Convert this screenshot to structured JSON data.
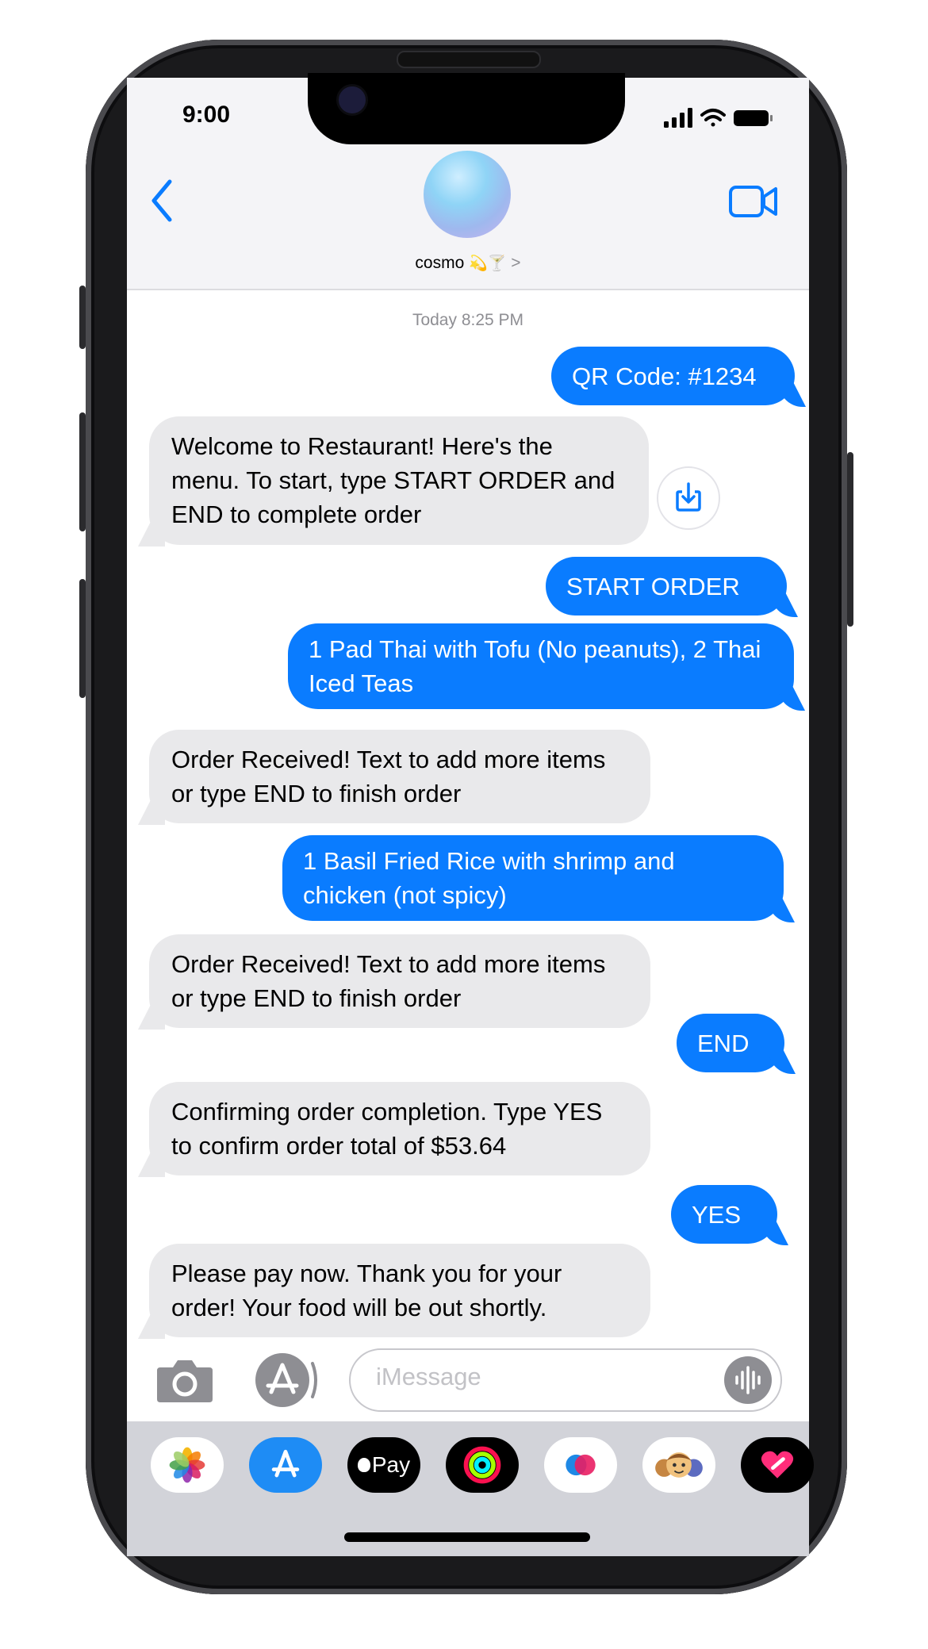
{
  "status_bar": {
    "time": "9:00"
  },
  "header": {
    "contact_name": "cosmo",
    "contact_emoji": "💫🍸",
    "chevron": ">"
  },
  "timestamp": "Today 8:25 PM",
  "messages": [
    {
      "from": "me",
      "text": "QR Code: #1234"
    },
    {
      "from": "them",
      "text": "Welcome to Restaurant! Here's the menu. To start, type START ORDER and END to complete order"
    },
    {
      "from": "me",
      "text": "START ORDER"
    },
    {
      "from": "me",
      "text": "1 Pad Thai with Tofu (No peanuts), 2 Thai Iced Teas"
    },
    {
      "from": "them",
      "text": "Order Received! Text to add more items or type END to finish order"
    },
    {
      "from": "me",
      "text": "1 Basil Fried Rice with shrimp and chicken (not spicy)"
    },
    {
      "from": "them",
      "text": "Order Received! Text to add more items or type END to finish order"
    },
    {
      "from": "me",
      "text": "END"
    },
    {
      "from": "them",
      "text": "Confirming order completion. Type YES to confirm order total of $53.64"
    },
    {
      "from": "me",
      "text": "YES"
    },
    {
      "from": "them",
      "text": "Please pay now. Thank you for your order! Your food will be out shortly."
    }
  ],
  "input": {
    "placeholder": "iMessage"
  },
  "apps": [
    {
      "name": "photos-app-icon"
    },
    {
      "name": "app-store-icon"
    },
    {
      "name": "apple-pay-icon",
      "label": "Pay"
    },
    {
      "name": "activity-icon"
    },
    {
      "name": "digital-touch-icon"
    },
    {
      "name": "memoji-icon"
    },
    {
      "name": "stickers-icon"
    }
  ],
  "colors": {
    "outgoing": "#0a7cff",
    "incoming": "#e9e9eb",
    "accent": "#0a7cff"
  }
}
